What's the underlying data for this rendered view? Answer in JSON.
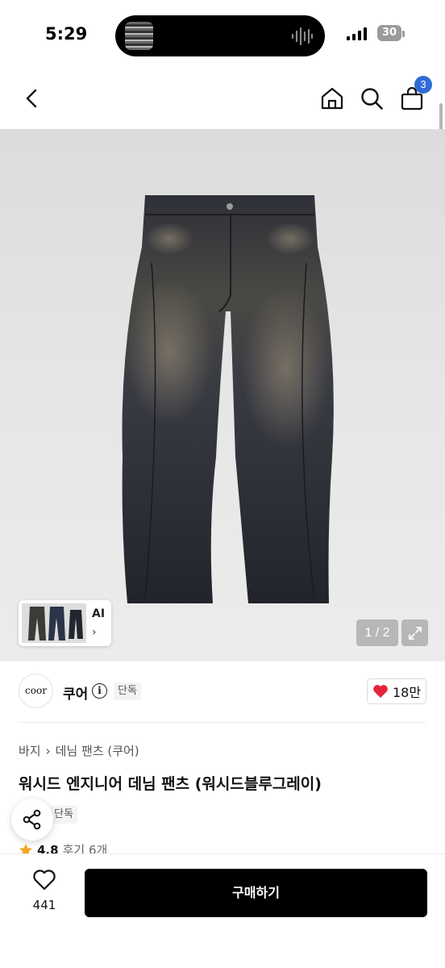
{
  "status_bar": {
    "time": "5:29",
    "battery": "30"
  },
  "header": {
    "cart_count": "3"
  },
  "gallery": {
    "pager": "1 / 2",
    "ai_label": "AI",
    "ai_chevron": "›"
  },
  "brand": {
    "logo_text": "coor",
    "name": "쿠어",
    "info": "i",
    "badge": "단독",
    "likes": "18만"
  },
  "product": {
    "breadcrumb": [
      "바지",
      "데님 팬츠 (쿠어)"
    ],
    "breadcrumb_sep": "›",
    "title": "워시드 엔지니어 데님 팬츠 (워시드블루그레이)",
    "badge": "단독",
    "rating": "4.8",
    "reviews": "후기 6개"
  },
  "bottom": {
    "wish_count": "441",
    "buy_label": "구매하기"
  },
  "colors": {
    "badge_blue": "#2f6bd8",
    "heart_red": "#e5243b",
    "star": "#f5a623",
    "buy_bg": "#000000"
  }
}
